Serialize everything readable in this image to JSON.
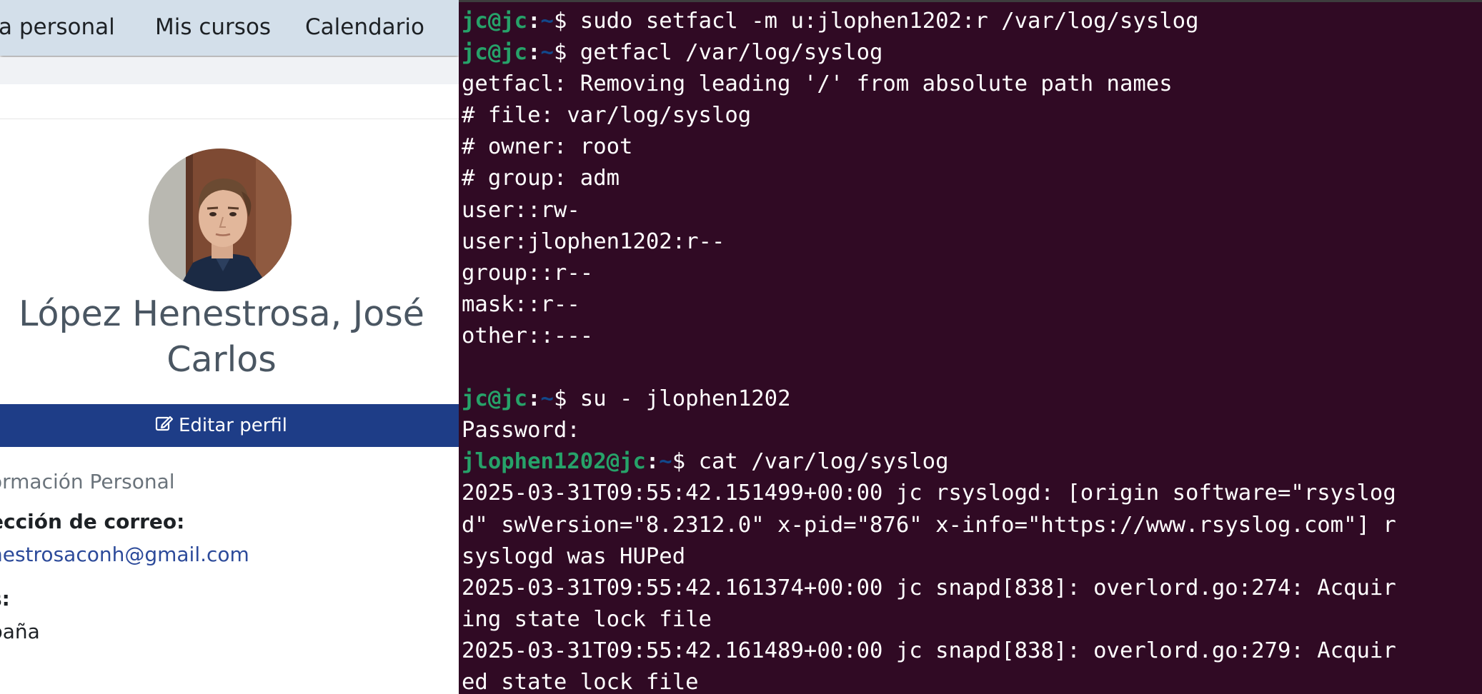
{
  "browser": {
    "nav": {
      "items": [
        {
          "label": "a personal"
        },
        {
          "label": "Mis cursos"
        },
        {
          "label": "Calendario"
        }
      ]
    },
    "profile": {
      "name_line1": "López Henestrosa, José",
      "name_line2": "Carlos",
      "edit_label": "Editar perfil",
      "info_heading": "ormación Personal",
      "email_label": "ección de correo:",
      "email_value": "nestrosaconh@gmail.com",
      "country_label": "s:",
      "country_value": "paña"
    }
  },
  "terminal": {
    "colors": {
      "background": "#300a24",
      "prompt_user": "#26a269",
      "prompt_path": "#12488b",
      "text": "#ffffff"
    },
    "lines": [
      {
        "prompt": {
          "user": "jc@jc",
          "sep": ":",
          "path": "~",
          "dollar": "$ "
        },
        "text": "sudo setfacl -m u:jlophen1202:r /var/log/syslog"
      },
      {
        "prompt": {
          "user": "jc@jc",
          "sep": ":",
          "path": "~",
          "dollar": "$ "
        },
        "text": "getfacl /var/log/syslog"
      },
      {
        "text": "getfacl: Removing leading '/' from absolute path names"
      },
      {
        "text": "# file: var/log/syslog"
      },
      {
        "text": "# owner: root"
      },
      {
        "text": "# group: adm"
      },
      {
        "text": "user::rw-"
      },
      {
        "text": "user:jlophen1202:r--"
      },
      {
        "text": "group::r--"
      },
      {
        "text": "mask::r--"
      },
      {
        "text": "other::---"
      },
      {
        "text": ""
      },
      {
        "prompt": {
          "user": "jc@jc",
          "sep": ":",
          "path": "~",
          "dollar": "$ "
        },
        "text": "su - jlophen1202"
      },
      {
        "text": "Password:"
      },
      {
        "prompt": {
          "user": "jlophen1202@jc",
          "sep": ":",
          "path": "~",
          "dollar": "$ "
        },
        "text": "cat /var/log/syslog"
      },
      {
        "text": "2025-03-31T09:55:42.151499+00:00 jc rsyslogd: [origin software=\"rsyslog"
      },
      {
        "text": "d\" swVersion=\"8.2312.0\" x-pid=\"876\" x-info=\"https://www.rsyslog.com\"] r"
      },
      {
        "text": "syslogd was HUPed"
      },
      {
        "text": "2025-03-31T09:55:42.161374+00:00 jc snapd[838]: overlord.go:274: Acquir"
      },
      {
        "text": "ing state lock file"
      },
      {
        "text": "2025-03-31T09:55:42.161489+00:00 jc snapd[838]: overlord.go:279: Acquir"
      },
      {
        "text": "ed state lock file"
      }
    ]
  }
}
